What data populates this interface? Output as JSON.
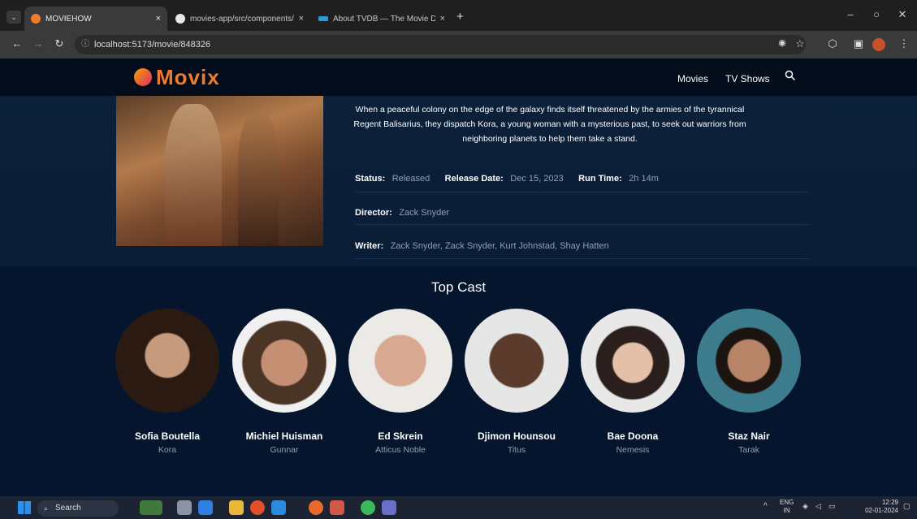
{
  "browser": {
    "tabs": [
      {
        "title": "MOVIEHOW",
        "active": true
      },
      {
        "title": "movies-app/src/components/...",
        "active": false
      },
      {
        "title": "About TVDB — The Movie Dat...",
        "active": false
      }
    ],
    "url": "localhost:5173/movie/848326",
    "new_tab": "+",
    "tab_close": "×"
  },
  "site": {
    "logo": "Movix",
    "nav": {
      "movies": "Movies",
      "tv_shows": "TV Shows"
    }
  },
  "movie": {
    "overview": "When a peaceful colony on the edge of the galaxy finds itself threatened by the armies of the tyrannical Regent Balisarius, they dispatch Kora, a young woman with a mysterious past, to seek out warriors from neighboring planets to help them take a stand.",
    "status_label": "Status:",
    "status": "Released",
    "release_label": "Release Date:",
    "release_date": "Dec 15, 2023",
    "runtime_label": "Run Time:",
    "runtime": "2h 14m",
    "director_label": "Director:",
    "director": "Zack Snyder",
    "writer_label": "Writer:",
    "writers": "Zack Snyder, Zack Snyder, Kurt Johnstad, Shay Hatten"
  },
  "cast": {
    "title": "Top Cast",
    "members": [
      {
        "name": "Sofia Boutella",
        "character": "Kora"
      },
      {
        "name": "Michiel Huisman",
        "character": "Gunnar"
      },
      {
        "name": "Ed Skrein",
        "character": "Atticus Noble"
      },
      {
        "name": "Djimon Hounsou",
        "character": "Titus"
      },
      {
        "name": "Bae Doona",
        "character": "Nemesis"
      },
      {
        "name": "Staz Nair",
        "character": "Tarak"
      }
    ]
  },
  "taskbar": {
    "search": "Search",
    "lang": "ENG",
    "region": "IN",
    "time": "12:29",
    "date": "02-01-2024"
  },
  "colors": {
    "accent": "#f07c2b",
    "page_bg": "#04152d",
    "muted_text": "#8fa0b5"
  }
}
